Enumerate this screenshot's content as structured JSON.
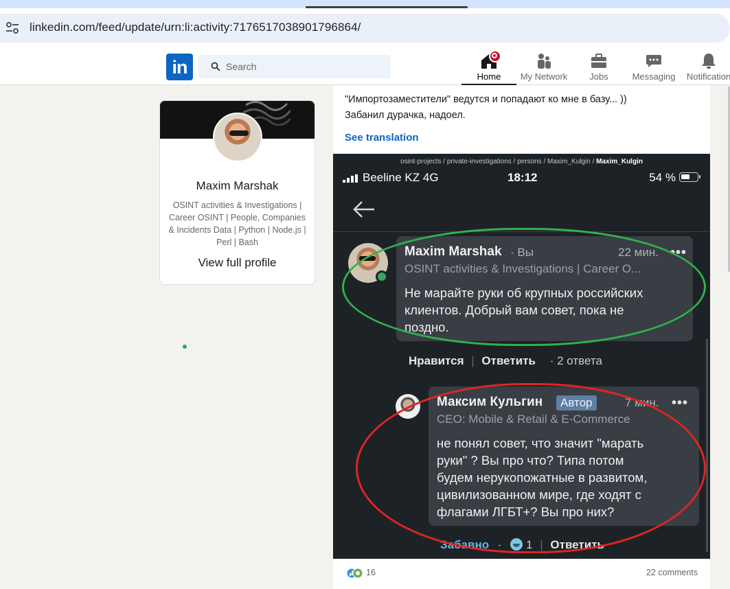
{
  "browser": {
    "url": "linkedin.com/feed/update/urn:li:activity:7176517038901796864/"
  },
  "header": {
    "logo": "in",
    "search_placeholder": "Search",
    "nav": {
      "home": "Home",
      "network": "My Network",
      "jobs": "Jobs",
      "messaging": "Messaging",
      "notifications": "Notification"
    }
  },
  "profile": {
    "name": "Maxim Marshak",
    "headline": "OSINT activities & Investigations | Career OSINT | People, Companies & Incidents Data | Python | Node.js | Perl | Bash",
    "view_full_profile": "View full profile"
  },
  "post": {
    "text": "\"Импортозаместители\" ведутся и попадают ко мне в базу... ))\nЗабанил дурачка, надоел.",
    "see_translation": "See translation",
    "image": {
      "path_prefix": "osint-projects / private-investigations / persons / Maxim_Kulgin / ",
      "path_last": "Maxim_Kulgin",
      "status": {
        "carrier": "Beeline KZ  4G",
        "time": "18:12",
        "battery": "54 %"
      },
      "comment1": {
        "author": "Maxim Marshak",
        "you": "· Вы",
        "time": "22 мин.",
        "more": "•••",
        "subtitle": "OSINT activities & Investigations | Career O...",
        "body": "Не марайте руки об крупных российских\nклиентов. Добрый вам совет, пока не\nпоздно."
      },
      "comment1_actions": {
        "like": "Нравится",
        "reply": "Ответить",
        "replies": "·   2 ответа"
      },
      "comment2": {
        "author": "Максим Кульгин",
        "badge": "Автор",
        "time": "7 мин.",
        "more": "•••",
        "subtitle": "CEO: Mobile & Retail & E-Commerce",
        "body": "не понял совет, что значит \"марать\nруки\" ? Вы про что? Типа потом\nбудем нерукопожатные в развитом,\nцивилизованном мире, где ходят с\nфлагами ЛГБТ+? Вы про них?"
      },
      "comment2_actions": {
        "funny": "Забавно",
        "sep": "·",
        "count": "1",
        "reply": "Ответить"
      }
    },
    "reactions_count": "16",
    "comments_count": "22 comments"
  }
}
